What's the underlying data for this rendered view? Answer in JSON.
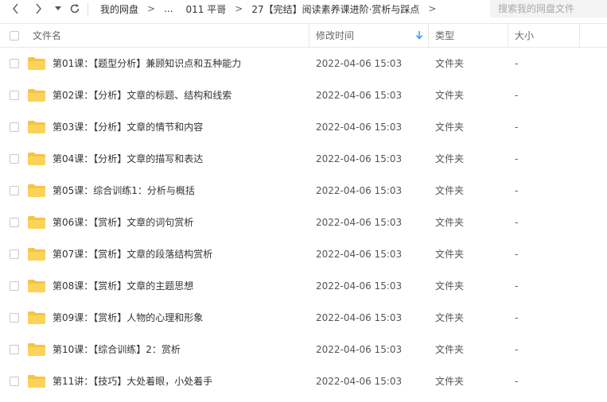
{
  "toolbar": {
    "breadcrumb": [
      "我的网盘",
      "...",
      "011 平哥",
      "27【完结】阅读素养课进阶·赏析与踩点"
    ],
    "crumb_separator": ">",
    "search_placeholder": "搜索我的网盘文件"
  },
  "columns": {
    "name": "文件名",
    "modified": "修改时间",
    "type": "类型",
    "size": "大小",
    "sort_direction": "descending"
  },
  "colors": {
    "folder": "#F7C342",
    "sort_arrow": "#2E9AFE"
  },
  "files": [
    {
      "name": "第01课：【题型分析】兼顾知识点和五种能力",
      "modified": "2022-04-06 15:03",
      "type": "文件夹",
      "size": "-"
    },
    {
      "name": "第02课：【分析】文章的标题、结构和线索",
      "modified": "2022-04-06 15:03",
      "type": "文件夹",
      "size": "-"
    },
    {
      "name": "第03课：【分析】文章的情节和内容",
      "modified": "2022-04-06 15:03",
      "type": "文件夹",
      "size": "-"
    },
    {
      "name": "第04课：【分析】文章的描写和表达",
      "modified": "2022-04-06 15:03",
      "type": "文件夹",
      "size": "-"
    },
    {
      "name": "第05课：综合训练1：分析与概括",
      "modified": "2022-04-06 15:03",
      "type": "文件夹",
      "size": "-"
    },
    {
      "name": "第06课：【赏析】文章的词句赏析",
      "modified": "2022-04-06 15:03",
      "type": "文件夹",
      "size": "-"
    },
    {
      "name": "第07课：【赏析】文章的段落结构赏析",
      "modified": "2022-04-06 15:03",
      "type": "文件夹",
      "size": "-"
    },
    {
      "name": "第08课：【赏析】文章的主题思想",
      "modified": "2022-04-06 15:03",
      "type": "文件夹",
      "size": "-"
    },
    {
      "name": "第09课：【赏析】人物的心理和形象",
      "modified": "2022-04-06 15:03",
      "type": "文件夹",
      "size": "-"
    },
    {
      "name": "第10课：【综合训练】2：赏析",
      "modified": "2022-04-06 15:03",
      "type": "文件夹",
      "size": "-"
    },
    {
      "name": "第11讲：【技巧】大处着眼，小处着手",
      "modified": "2022-04-06 15:03",
      "type": "文件夹",
      "size": "-"
    }
  ]
}
